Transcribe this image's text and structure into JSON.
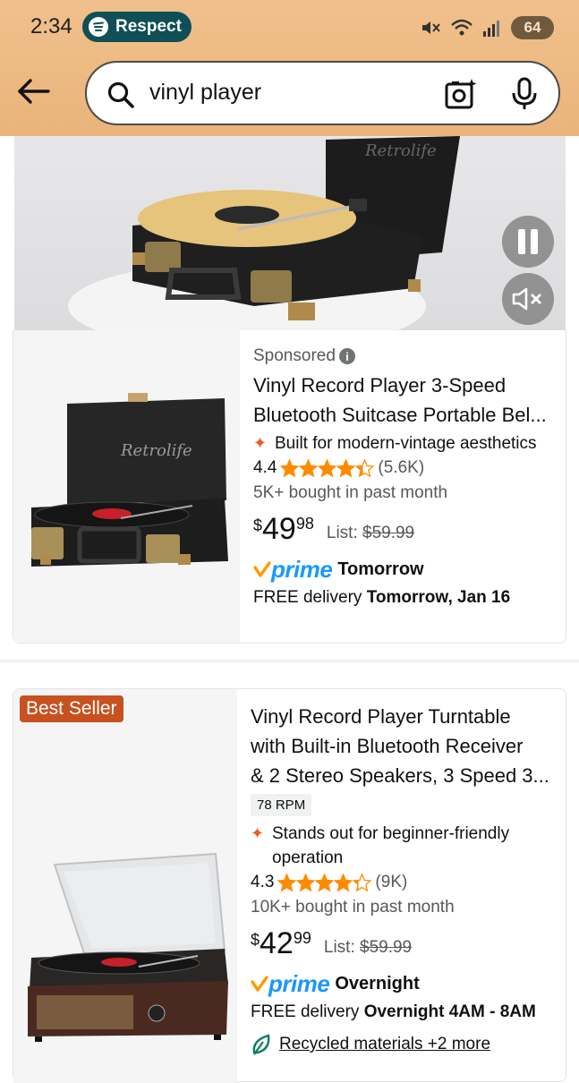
{
  "status_bar": {
    "time": "2:34",
    "spotify_label": "Respect",
    "battery": "64"
  },
  "search": {
    "query": "vinyl player"
  },
  "products": [
    {
      "sponsored": "Sponsored",
      "title_line1": "Vinyl Record Player 3-Speed",
      "title_line2": "Bluetooth Suitcase Portable Bel...",
      "highlight": "Built for modern-vintage aesthetics",
      "rating": "4.4",
      "stars": 4.4,
      "reviews": "(5.6K)",
      "bought": "5K+ bought in past month",
      "price_symbol": "$",
      "price_whole": "49",
      "price_fraction": "98",
      "list_label": "List:",
      "list_price": "$59.99",
      "prime": "prime",
      "prime_when": "Tomorrow",
      "delivery_prefix": "FREE delivery",
      "delivery_when": "Tomorrow, Jan 16"
    },
    {
      "badge": "Best Seller",
      "title_line1": "Vinyl Record Player Turntable",
      "title_line2": "with Built-in Bluetooth Receiver",
      "title_line3": "& 2 Stereo Speakers, 3 Speed 3...",
      "option": "78 RPM",
      "highlight_line1": "Stands out for beginner-friendly",
      "highlight_line2": "operation",
      "rating": "4.3",
      "stars": 4.3,
      "reviews": "(9K)",
      "bought": "10K+ bought in past month",
      "price_symbol": "$",
      "price_whole": "42",
      "price_fraction": "99",
      "list_label": "List:",
      "list_price": "$59.99",
      "prime": "prime",
      "prime_when": "Overnight",
      "delivery_prefix": "FREE delivery",
      "delivery_when": "Overnight 4AM - 8AM",
      "eco": "Recycled materials +2 more"
    }
  ],
  "video": {
    "brand_text": "Retrolife"
  },
  "colors": {
    "header": "#eab47b",
    "star": "#ff8a00",
    "prime": "#1a98ff",
    "badge": "#c7511f"
  }
}
